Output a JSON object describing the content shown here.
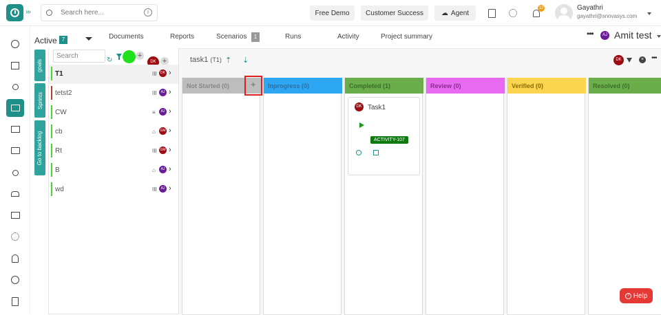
{
  "header": {
    "search_placeholder": "Search here...",
    "free_demo": "Free Demo",
    "customer_success": "Customer Success",
    "agent": "Agent",
    "notif_count": "12",
    "user_name": "Gayathri",
    "user_email": "gayathri@snovasys.com"
  },
  "subheader": {
    "active_label": "Active",
    "active_count": "7",
    "tabs": [
      "Documents",
      "Reports",
      "Scenarios",
      "Runs",
      "Activity",
      "Project summary"
    ],
    "scenarios_count": "1",
    "user_initials": "AJ",
    "user_name": "Amit test"
  },
  "side_tabs": [
    "goals",
    "Sprints",
    "Go to backlog"
  ],
  "task_list": {
    "search_placeholder": "Search",
    "owner_initials": "DK",
    "rows": [
      {
        "name": "T1",
        "bar": "#4cd137",
        "pri": "III",
        "av": "DK",
        "avc": "#9b0d12",
        "bold": true
      },
      {
        "name": "tetst2",
        "bar": "#c0392b",
        "pri": "III",
        "av": "AJ",
        "avc": "#6a1b9a"
      },
      {
        "name": "CW",
        "bar": "#4cd137",
        "pri": "≡",
        "av": "AJ",
        "avc": "#6a1b9a"
      },
      {
        "name": "cb",
        "bar": "#4cd137",
        "pri": "⌂",
        "av": "GM",
        "avc": "#9b0d12"
      },
      {
        "name": "Rt",
        "bar": "#4cd137",
        "pri": "III",
        "av": "GM",
        "avc": "#9b0d12"
      },
      {
        "name": "B",
        "bar": "#4cd137",
        "pri": "⌂",
        "av": "AJ",
        "avc": "#6a1b9a"
      },
      {
        "name": "wd",
        "bar": "#4cd137",
        "pri": "III",
        "av": "AJ",
        "avc": "#6a1b9a"
      }
    ]
  },
  "board": {
    "title": "task1",
    "title_code": "(T1)",
    "owner_initials": "DK",
    "columns": [
      {
        "label": "Not Started (0)",
        "color": "#bdbdbd",
        "text": "#888"
      },
      {
        "label": "Inprogress (0)",
        "color": "#2ea7f2",
        "text": "#2f6f9f"
      },
      {
        "label": "Completed (1)",
        "color": "#6aad4a",
        "text": "#3d6e2a"
      },
      {
        "label": "Review (0)",
        "color": "#e86af0",
        "text": "#8b2c92"
      },
      {
        "label": "Verified (0)",
        "color": "#fbd54f",
        "text": "#8a6d00"
      },
      {
        "label": "Resolved (0)",
        "color": "#6aad4a",
        "text": "#3d6e2a"
      }
    ],
    "card": {
      "title": "Task1",
      "initials": "DK",
      "tag": "ACTIVITY-107"
    }
  },
  "help_label": "Help"
}
